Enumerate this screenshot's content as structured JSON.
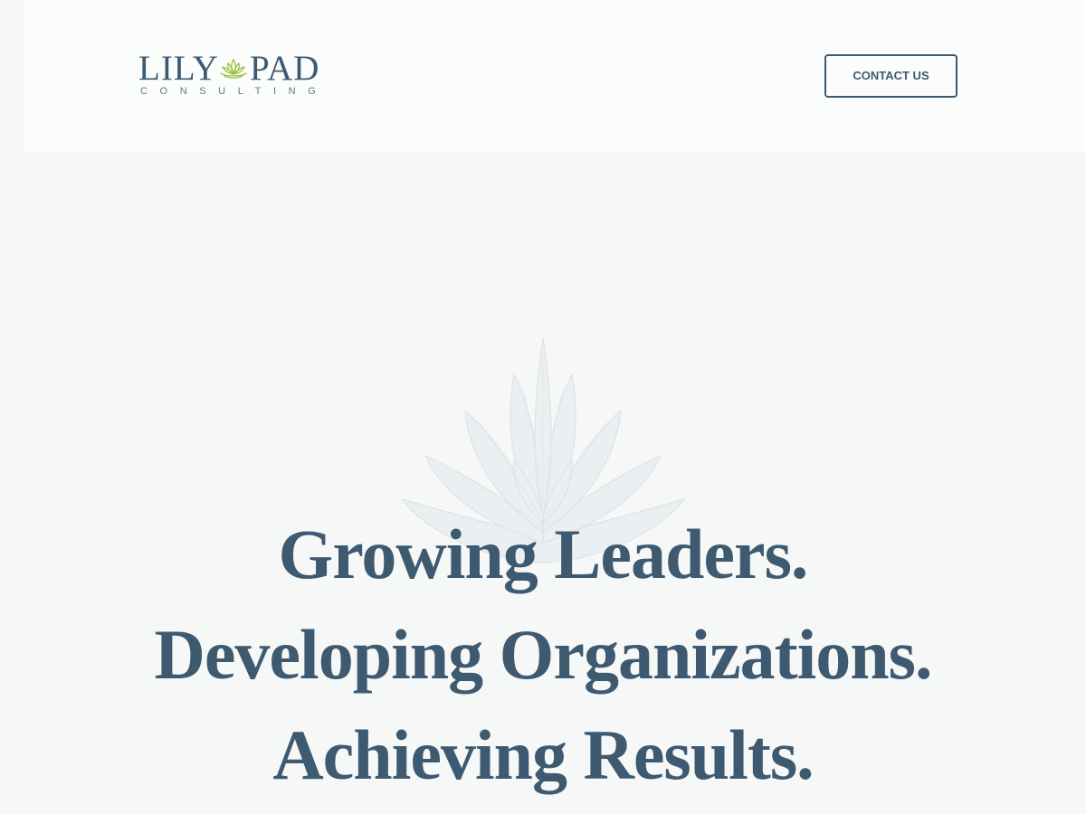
{
  "header": {
    "logo": {
      "word_left": "LILY",
      "word_right": "PAD",
      "subtitle": "CONSULTING",
      "icon": "lotus-icon"
    },
    "contact_button": "CONTACT US"
  },
  "hero": {
    "background_icon": "lotus-flower-illustration",
    "headline_lines": [
      "Growing Leaders.",
      "Developing Organizations.",
      "Achieving Results."
    ]
  },
  "colors": {
    "brand_navy": "#3e5a70",
    "brand_green": "#9bbf3f",
    "page_background": "#f6f7f7",
    "header_background": "#fbfcfc"
  }
}
